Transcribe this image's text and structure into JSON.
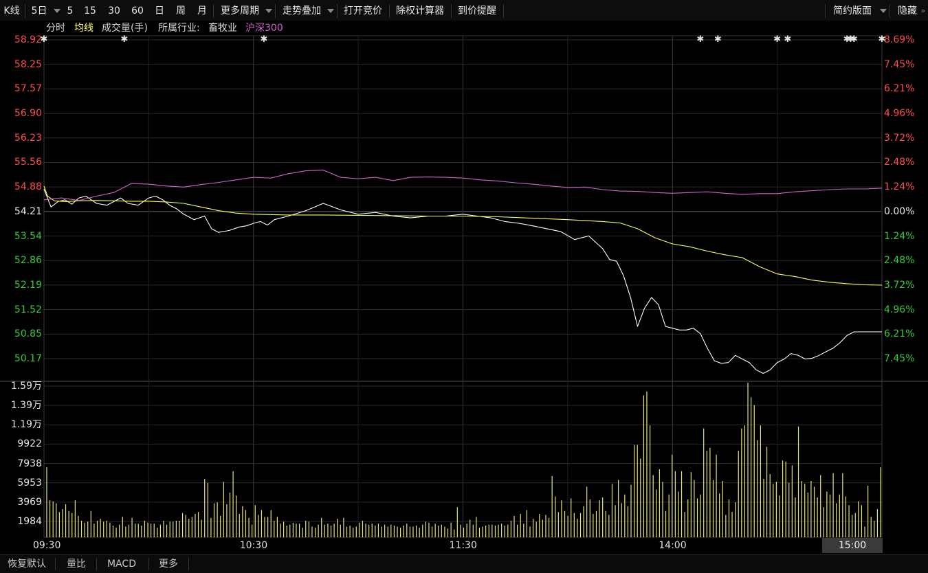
{
  "toolbar": {
    "kline": "K线",
    "period_selected": "5日",
    "p5": "5",
    "p15": "15",
    "p30": "30",
    "p60": "60",
    "day": "日",
    "week": "周",
    "month": "月",
    "more_periods": "更多周期",
    "overlay": "走势叠加",
    "auction": "打开竞价",
    "calculator": "除权计算器",
    "price_alert": "到价提醒",
    "layout": "简约版面",
    "hide": "隐藏"
  },
  "legend": {
    "timeshare": "分时",
    "avg_line": "均线",
    "volume": "成交量(手)",
    "industry_label": "所属行业:",
    "industry": "畜牧业",
    "index": "沪深300"
  },
  "bottom_tabs": [
    "恢复默认",
    "量比",
    "MACD",
    "更多"
  ],
  "colors": {
    "up": "#ff4c4c",
    "down": "#33cc33",
    "price_line": "#ffffff",
    "avg_line": "#ffff55",
    "index_line": "#cc66cc",
    "volume_bar": "#e6e67a",
    "grid": "#2b2b2b"
  },
  "chart_data": {
    "type": "line",
    "price_axis": {
      "ticks": [
        "58.92",
        "58.25",
        "57.57",
        "56.90",
        "56.23",
        "55.56",
        "54.88",
        "54.21",
        "53.54",
        "52.86",
        "52.19",
        "51.52",
        "50.85",
        "50.17"
      ],
      "ylim": [
        49.9,
        58.92
      ],
      "base_price": 54.21
    },
    "percent_axis": {
      "ticks": [
        "8.69%",
        "7.45%",
        "6.21%",
        "4.96%",
        "3.72%",
        "2.48%",
        "1.24%",
        "0.00%",
        "1.24%",
        "2.48%",
        "3.72%",
        "4.96%",
        "6.21%",
        "7.45%"
      ]
    },
    "volume_axis": {
      "ticks": [
        "1.59万",
        "1.39万",
        "1.19万",
        "9922",
        "7938",
        "5953",
        "3969",
        "1984"
      ],
      "ylim": [
        0,
        15900
      ]
    },
    "x_axis": {
      "ticks": [
        "09:30",
        "10:30",
        "11:30",
        "14:00",
        "15:00"
      ],
      "last_label": "15:00",
      "minutes_total": 240
    },
    "series": [
      {
        "name": "分时",
        "x": [
          0,
          2,
          4,
          6,
          8,
          10,
          12,
          15,
          18,
          20,
          22,
          24,
          27,
          30,
          32,
          34,
          36,
          38,
          40,
          43,
          46,
          48,
          50,
          53,
          56,
          58,
          60,
          62,
          64,
          66,
          70,
          75,
          80,
          85,
          90,
          95,
          100,
          105,
          110,
          115,
          120,
          124,
          128,
          132,
          136,
          140,
          144,
          148,
          152,
          156,
          160,
          162,
          164,
          166,
          168,
          170,
          172,
          174,
          176,
          178,
          180,
          182,
          184,
          186,
          188,
          190,
          192,
          194,
          196,
          198,
          200,
          202,
          204,
          206,
          208,
          210,
          212,
          214,
          216,
          218,
          220,
          222,
          224,
          226,
          228,
          230,
          232,
          234,
          236,
          238,
          240
        ],
        "values": [
          54.8,
          54.3,
          54.45,
          54.5,
          54.38,
          54.55,
          54.6,
          54.4,
          54.35,
          54.45,
          54.55,
          54.4,
          54.35,
          54.55,
          54.6,
          54.5,
          54.35,
          54.25,
          54.1,
          53.95,
          54.05,
          53.7,
          53.6,
          53.65,
          53.75,
          53.78,
          53.85,
          53.9,
          53.8,
          53.95,
          54.05,
          54.2,
          54.4,
          54.22,
          54.1,
          54.15,
          54.05,
          54.0,
          54.05,
          54.05,
          54.1,
          54.05,
          54.0,
          53.9,
          53.85,
          53.78,
          53.7,
          53.62,
          53.4,
          53.5,
          53.15,
          52.85,
          52.8,
          52.4,
          51.8,
          51.0,
          51.5,
          51.8,
          51.6,
          51.0,
          50.95,
          50.9,
          50.9,
          50.95,
          50.8,
          50.4,
          50.05,
          49.98,
          50.0,
          50.2,
          50.1,
          50.0,
          49.8,
          49.7,
          49.8,
          50.0,
          50.1,
          50.25,
          50.2,
          50.1,
          50.12,
          50.2,
          50.3,
          50.4,
          50.55,
          50.75,
          50.85,
          50.85,
          50.85,
          50.85,
          50.85
        ]
      },
      {
        "name": "均线",
        "x": [
          0,
          1,
          3,
          6,
          10,
          15,
          20,
          25,
          30,
          35,
          40,
          45,
          50,
          55,
          60,
          70,
          80,
          90,
          100,
          110,
          120,
          130,
          140,
          150,
          160,
          165,
          170,
          175,
          180,
          185,
          190,
          195,
          200,
          205,
          210,
          215,
          220,
          225,
          230,
          235,
          240
        ],
        "values": [
          54.88,
          54.6,
          54.47,
          54.45,
          54.47,
          54.48,
          54.47,
          54.46,
          54.46,
          54.44,
          54.4,
          54.3,
          54.2,
          54.13,
          54.1,
          54.08,
          54.08,
          54.07,
          54.06,
          54.05,
          54.05,
          54.03,
          53.99,
          53.95,
          53.9,
          53.86,
          53.7,
          53.45,
          53.28,
          53.2,
          53.08,
          52.98,
          52.9,
          52.65,
          52.45,
          52.38,
          52.28,
          52.22,
          52.18,
          52.15,
          52.14
        ]
      },
      {
        "name": "沪深300",
        "x": [
          0,
          5,
          10,
          15,
          20,
          25,
          30,
          35,
          40,
          45,
          50,
          55,
          60,
          65,
          70,
          75,
          80,
          85,
          90,
          95,
          100,
          105,
          110,
          115,
          120,
          125,
          130,
          135,
          140,
          145,
          150,
          155,
          160,
          165,
          170,
          175,
          180,
          185,
          190,
          195,
          200,
          205,
          210,
          215,
          220,
          225,
          230,
          235,
          240
        ],
        "values": [
          54.5,
          54.55,
          54.48,
          54.6,
          54.7,
          54.95,
          54.93,
          54.88,
          54.85,
          54.92,
          54.98,
          55.05,
          55.12,
          55.1,
          55.22,
          55.3,
          55.32,
          55.12,
          55.08,
          55.12,
          55.03,
          55.12,
          55.13,
          55.12,
          55.1,
          55.05,
          55.02,
          54.97,
          54.93,
          54.88,
          54.84,
          54.85,
          54.78,
          54.74,
          54.73,
          54.7,
          54.68,
          54.7,
          54.72,
          54.68,
          54.65,
          54.67,
          54.67,
          54.72,
          54.75,
          54.78,
          54.8,
          54.8,
          54.82
        ]
      }
    ],
    "volume": {
      "values": [
        7200,
        3800,
        3700,
        3500,
        2600,
        2900,
        3400,
        2700,
        2500,
        3800,
        2200,
        1700,
        1500,
        1600,
        2700,
        1400,
        1700,
        1900,
        1600,
        1700,
        1500,
        1200,
        1000,
        1300,
        2100,
        1100,
        1300,
        2000,
        1400,
        1400,
        1200,
        1700,
        1500,
        1400,
        1400,
        1000,
        1300,
        1700,
        1300,
        1600,
        1600,
        1700,
        1700,
        2500,
        2300,
        1900,
        2100,
        2400,
        2600,
        1800,
        6000,
        5600,
        2000,
        3500,
        3600,
        2200,
        5700,
        3400,
        4600,
        6800,
        4300,
        2400,
        3200,
        2800,
        2000,
        1300,
        3300,
        2300,
        2800,
        2100,
        2100,
        2800,
        1700,
        2100,
        1400,
        1600,
        1200,
        1300,
        1500,
        1400,
        1400,
        1000,
        1700,
        1600,
        1100,
        1000,
        1300,
        2000,
        1300,
        1400,
        1200,
        1400,
        1900,
        1300,
        2000,
        1100,
        1200,
        1000,
        1100,
        1500,
        1700,
        1400,
        1300,
        1400,
        1200,
        1400,
        1100,
        1300,
        1100,
        1300,
        1200,
        1100,
        1000,
        1200,
        1400,
        1100,
        1100,
        1200,
        1000,
        1300,
        1600,
        1500,
        1100,
        1400,
        1200,
        1300,
        1100,
        900,
        1500,
        800,
        3100,
        1300,
        1000,
        1400,
        1800,
        1300,
        2100,
        1000,
        1100,
        1200,
        1300,
        1300,
        1200,
        1300,
        1400,
        1200,
        1300,
        1700,
        2200,
        1300,
        2400,
        1400,
        2800,
        1100,
        1900,
        1600,
        2400,
        1800,
        2300,
        2000,
        6300,
        4200,
        2600,
        3800,
        2700,
        2200,
        4000,
        2500,
        1900,
        2500,
        3200,
        5200,
        3900,
        2400,
        2700,
        3800,
        4100,
        2700,
        2300,
        5500,
        3300,
        5900,
        3500,
        4400,
        3200,
        5400,
        9500,
        9500,
        8100,
        14600,
        15000,
        11500,
        6400,
        4900,
        7000,
        5700,
        2700,
        4400,
        8500,
        6800,
        4700,
        6800,
        2600,
        3900,
        6700,
        5900,
        4000,
        4400,
        11200,
        8900,
        9200,
        5900,
        8500,
        4500,
        5800,
        2300,
        3900,
        2600,
        3600,
        8900,
        11200,
        11500,
        15900,
        14400,
        13600,
        10000,
        11500,
        6000,
        9300,
        6500,
        5500,
        5700,
        4300,
        7900,
        7800,
        5600,
        7400,
        4100,
        11400,
        5800,
        5500,
        4600,
        5800,
        5200,
        4100,
        6400,
        3100,
        4700,
        4400,
        6600,
        3500,
        4400,
        6600,
        4200,
        3300,
        2300,
        2500,
        3700,
        3300,
        1100,
        5300,
        2100,
        1700,
        2900,
        7200
      ]
    },
    "event_markers_x": [
      0,
      23,
      63,
      188,
      193,
      210,
      213,
      230,
      231,
      232,
      240
    ]
  }
}
